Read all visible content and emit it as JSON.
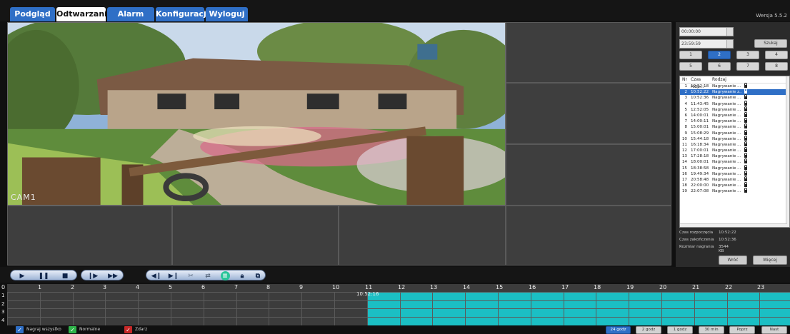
{
  "tabs": [
    {
      "label": "Podgląd",
      "active": false
    },
    {
      "label": "Odtwarzanie",
      "active": true
    },
    {
      "label": "Alarm",
      "active": false
    },
    {
      "label": "Konfiguracja",
      "active": false
    },
    {
      "label": "Wyloguj",
      "active": false
    }
  ],
  "version": "Wersja 5.5.2",
  "video": {
    "cam_label": "CAM1"
  },
  "search": {
    "start_time": "00:00:00",
    "end_time": "23:59:59",
    "search_button": "Szukaj",
    "channels": [
      "1",
      "2",
      "3",
      "4",
      "5",
      "6",
      "7",
      "8"
    ],
    "selected_channel": "2"
  },
  "recordings": {
    "headers": [
      "Nr",
      "Czas rozp...",
      "Rodzaj"
    ],
    "rows": [
      {
        "nr": "1",
        "time": "10:52:18",
        "type": "Nagrywanie ..."
      },
      {
        "nr": "2",
        "time": "10:52:22",
        "type": "Nagrywanie z..."
      },
      {
        "nr": "3",
        "time": "10:52:36",
        "type": "Nagrywanie ..."
      },
      {
        "nr": "4",
        "time": "11:43:45",
        "type": "Nagrywanie ..."
      },
      {
        "nr": "5",
        "time": "12:52:05",
        "type": "Nagrywanie ..."
      },
      {
        "nr": "6",
        "time": "14:00:01",
        "type": "Nagrywanie ..."
      },
      {
        "nr": "7",
        "time": "14:00:11",
        "type": "Nagrywanie ..."
      },
      {
        "nr": "8",
        "time": "15:00:01",
        "type": "Nagrywanie ..."
      },
      {
        "nr": "9",
        "time": "15:08:29",
        "type": "Nagrywanie ..."
      },
      {
        "nr": "10",
        "time": "15:44:18",
        "type": "Nagrywanie ..."
      },
      {
        "nr": "11",
        "time": "16:18:34",
        "type": "Nagrywanie ..."
      },
      {
        "nr": "12",
        "time": "17:00:01",
        "type": "Nagrywanie ..."
      },
      {
        "nr": "13",
        "time": "17:28:18",
        "type": "Nagrywanie ..."
      },
      {
        "nr": "14",
        "time": "18:00:01",
        "type": "Nagrywanie ..."
      },
      {
        "nr": "15",
        "time": "18:38:58",
        "type": "Nagrywanie ..."
      },
      {
        "nr": "16",
        "time": "19:49:34",
        "type": "Nagrywanie ..."
      },
      {
        "nr": "17",
        "time": "20:58:48",
        "type": "Nagrywanie ..."
      },
      {
        "nr": "18",
        "time": "22:00:00",
        "type": "Nagrywanie ..."
      },
      {
        "nr": "19",
        "time": "22:07:08",
        "type": "Nagrywanie ..."
      }
    ],
    "selected_index": 1
  },
  "details": {
    "start_label": "Czas rozpoczęcia",
    "start_value": "10:52:22",
    "end_label": "Czas zakończenia",
    "end_value": "10:52:36",
    "size_label": "Rozmiar nagrania",
    "size_value": "3544 KB"
  },
  "nav": {
    "back": "Wróć",
    "more": "Więcej"
  },
  "timeline": {
    "hours": [
      "0",
      "1",
      "2",
      "3",
      "4",
      "5",
      "6",
      "7",
      "8",
      "9",
      "10",
      "11",
      "12",
      "13",
      "14",
      "15",
      "16",
      "17",
      "18",
      "19",
      "20",
      "21",
      "22",
      "23"
    ],
    "rows": [
      "1",
      "2",
      "3",
      "4"
    ],
    "cursor_time": "10:52:16",
    "record_color": "#1bbfc4"
  },
  "filters": [
    {
      "label": "Nagraj wszystko",
      "color": "#2f6fc6"
    },
    {
      "label": "Normalne",
      "color": "#2fb34a"
    },
    {
      "label": "Zdarz",
      "color": "#c62828"
    }
  ],
  "zoom": [
    {
      "label": "24 godz",
      "selected": true
    },
    {
      "label": "2 godz",
      "selected": false
    },
    {
      "label": "1 godz",
      "selected": false
    },
    {
      "label": "30 min",
      "selected": false
    },
    {
      "label": "Poprz",
      "selected": false
    },
    {
      "label": "Nast",
      "selected": false
    }
  ]
}
